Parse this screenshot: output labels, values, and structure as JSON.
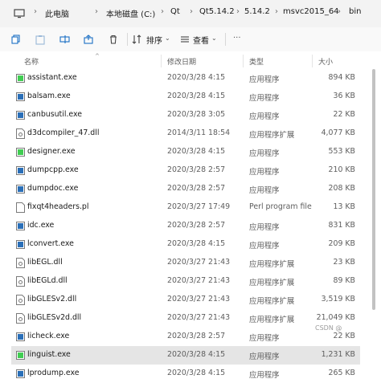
{
  "address_bar": {
    "segments": [
      "此电脑",
      "本地磁盘 (C:)",
      "Qt",
      "Qt5.14.2",
      "5.14.2",
      "msvc2015_64",
      "bin"
    ]
  },
  "toolbar": {
    "sort_label": "排序",
    "view_label": "查看",
    "more_label": "···"
  },
  "columns": {
    "name": "名称",
    "date": "修改日期",
    "type": "类型",
    "size": "大小"
  },
  "files": [
    {
      "name": "assistant.exe",
      "date": "2020/3/28 4:15",
      "type": "应用程序",
      "size": "894 KB",
      "icon": "qt-exe-icon"
    },
    {
      "name": "balsam.exe",
      "date": "2020/3/28 4:15",
      "type": "应用程序",
      "size": "36 KB",
      "icon": "exe-icon"
    },
    {
      "name": "canbusutil.exe",
      "date": "2020/3/28 3:05",
      "type": "应用程序",
      "size": "22 KB",
      "icon": "exe-icon"
    },
    {
      "name": "d3dcompiler_47.dll",
      "date": "2014/3/11 18:54",
      "type": "应用程序扩展",
      "size": "4,077 KB",
      "icon": "dll-icon"
    },
    {
      "name": "designer.exe",
      "date": "2020/3/28 4:15",
      "type": "应用程序",
      "size": "553 KB",
      "icon": "qt-exe-icon"
    },
    {
      "name": "dumpcpp.exe",
      "date": "2020/3/28 2:57",
      "type": "应用程序",
      "size": "210 KB",
      "icon": "exe-icon"
    },
    {
      "name": "dumpdoc.exe",
      "date": "2020/3/28 2:57",
      "type": "应用程序",
      "size": "208 KB",
      "icon": "exe-icon"
    },
    {
      "name": "fixqt4headers.pl",
      "date": "2020/3/27 17:49",
      "type": "Perl program file",
      "size": "13 KB",
      "icon": "file-icon"
    },
    {
      "name": "idc.exe",
      "date": "2020/3/28 2:57",
      "type": "应用程序",
      "size": "831 KB",
      "icon": "exe-icon"
    },
    {
      "name": "lconvert.exe",
      "date": "2020/3/28 4:15",
      "type": "应用程序",
      "size": "209 KB",
      "icon": "exe-icon"
    },
    {
      "name": "libEGL.dll",
      "date": "2020/3/27 21:43",
      "type": "应用程序扩展",
      "size": "23 KB",
      "icon": "dll-icon"
    },
    {
      "name": "libEGLd.dll",
      "date": "2020/3/27 21:43",
      "type": "应用程序扩展",
      "size": "89 KB",
      "icon": "dll-icon"
    },
    {
      "name": "libGLESv2.dll",
      "date": "2020/3/27 21:43",
      "type": "应用程序扩展",
      "size": "3,519 KB",
      "icon": "dll-icon"
    },
    {
      "name": "libGLESv2d.dll",
      "date": "2020/3/27 21:43",
      "type": "应用程序扩展",
      "size": "21,049 KB",
      "icon": "dll-icon"
    },
    {
      "name": "licheck.exe",
      "date": "2020/3/28 2:57",
      "type": "应用程序",
      "size": "22 KB",
      "icon": "exe-icon"
    },
    {
      "name": "linguist.exe",
      "date": "2020/3/28 4:15",
      "type": "应用程序",
      "size": "1,231 KB",
      "icon": "qt-exe-icon",
      "highlighted": true
    },
    {
      "name": "lprodump.exe",
      "date": "2020/3/28 4:15",
      "type": "应用程序",
      "size": "265 KB",
      "icon": "exe-icon"
    }
  ],
  "watermark": "CSDN @"
}
